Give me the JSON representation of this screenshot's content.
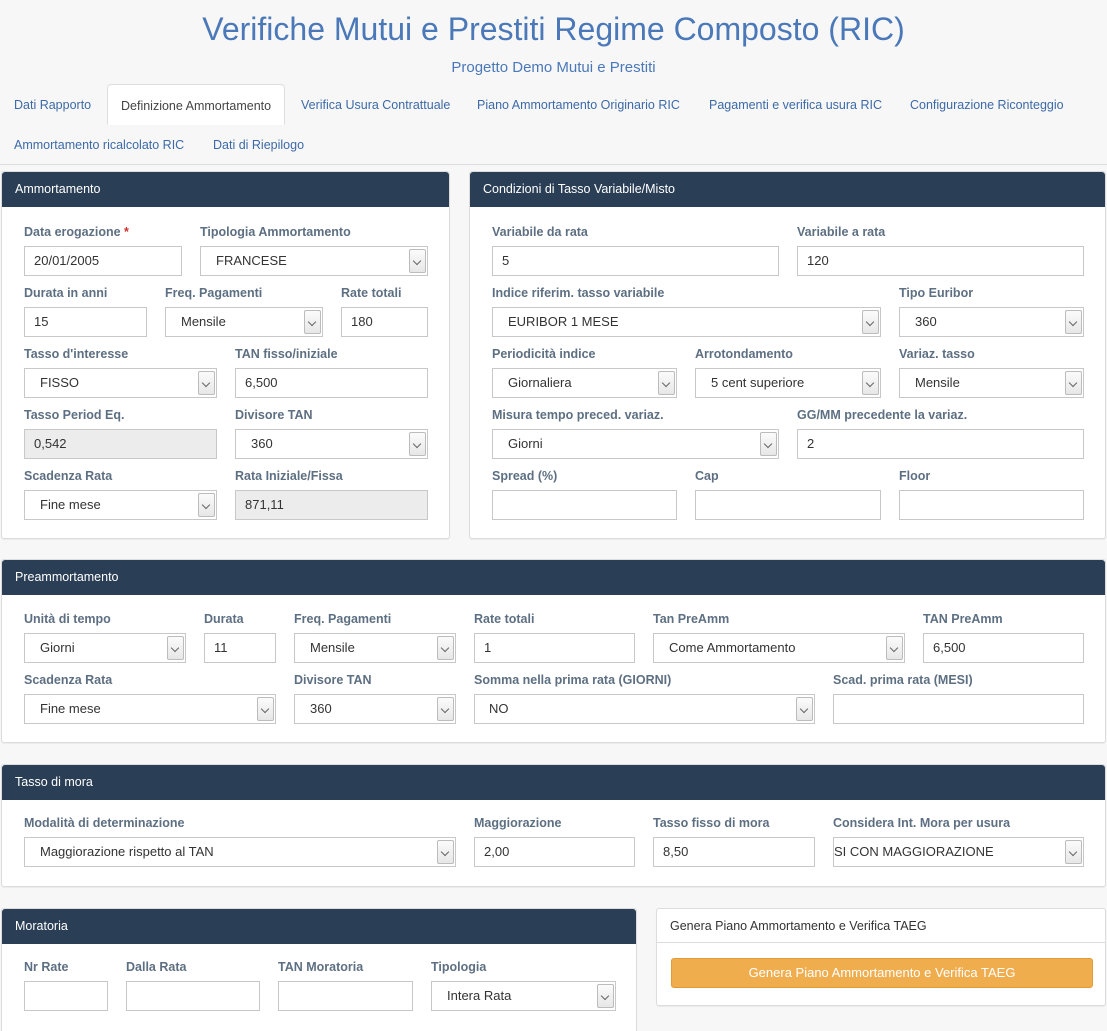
{
  "header": {
    "title": "Verifiche Mutui e Prestiti Regime Composto (RIC)",
    "subtitle": "Progetto Demo Mutui e Prestiti"
  },
  "tabs": [
    {
      "label": "Dati Rapporto"
    },
    {
      "label": "Definizione Ammortamento",
      "active": true
    },
    {
      "label": "Verifica Usura Contrattuale"
    },
    {
      "label": "Piano Ammortamento Originario RIC"
    },
    {
      "label": "Pagamenti e verifica usura RIC"
    },
    {
      "label": "Configurazione Riconteggio"
    },
    {
      "label": "Ammortamento ricalcolato RIC"
    },
    {
      "label": "Dati di Riepilogo"
    }
  ],
  "ammortamento": {
    "heading": "Ammortamento",
    "data_erogazione": {
      "label": "Data erogazione",
      "required_mark": "*",
      "value": "20/01/2005"
    },
    "tipologia": {
      "label": "Tipologia Ammortamento",
      "value": "FRANCESE"
    },
    "durata_anni": {
      "label": "Durata in anni",
      "value": "15"
    },
    "freq_pagamenti": {
      "label": "Freq. Pagamenti",
      "value": "Mensile"
    },
    "rate_totali": {
      "label": "Rate totali",
      "value": "180"
    },
    "tasso_interesse": {
      "label": "Tasso d'interesse",
      "value": "FISSO"
    },
    "tan_fisso": {
      "label": "TAN fisso/iniziale",
      "value": "6,500"
    },
    "tasso_period": {
      "label": "Tasso Period Eq.",
      "value": "0,542"
    },
    "divisore_tan": {
      "label": "Divisore TAN",
      "value": "360"
    },
    "scadenza_rata": {
      "label": "Scadenza Rata",
      "value": "Fine mese"
    },
    "rata_iniziale": {
      "label": "Rata Iniziale/Fissa",
      "value": "871,11"
    }
  },
  "condizioni": {
    "heading": "Condizioni di Tasso Variabile/Misto",
    "variabile_da_rata": {
      "label": "Variabile da rata",
      "value": "5"
    },
    "variabile_a_rata": {
      "label": "Variabile a rata",
      "value": "120"
    },
    "indice_riferim": {
      "label": "Indice riferim. tasso variabile",
      "value": "EURIBOR 1 MESE"
    },
    "tipo_euribor": {
      "label": "Tipo Euribor",
      "value": "360"
    },
    "periodicita": {
      "label": "Periodicità indice",
      "value": "Giornaliera"
    },
    "arrotondamento": {
      "label": "Arrotondamento",
      "value": "5 cent superiore"
    },
    "variaz_tasso": {
      "label": "Variaz. tasso",
      "value": "Mensile"
    },
    "misura_tempo": {
      "label": "Misura tempo preced. variaz.",
      "value": "Giorni"
    },
    "gg_mm": {
      "label": "GG/MM precedente la variaz.",
      "value": "2"
    },
    "spread": {
      "label": "Spread (%)",
      "value": ""
    },
    "cap": {
      "label": "Cap",
      "value": ""
    },
    "floor": {
      "label": "Floor",
      "value": ""
    }
  },
  "preammortamento": {
    "heading": "Preammortamento",
    "unita_tempo": {
      "label": "Unità di tempo",
      "value": "Giorni"
    },
    "durata": {
      "label": "Durata",
      "value": "11"
    },
    "freq_pagamenti": {
      "label": "Freq. Pagamenti",
      "value": "Mensile"
    },
    "rate_totali": {
      "label": "Rate totali",
      "value": "1"
    },
    "tan_preamm_sel": {
      "label": "Tan PreAmm",
      "value": "Come Ammortamento"
    },
    "tan_preamm_val": {
      "label": "TAN PreAmm",
      "value": "6,500"
    },
    "scadenza_rata": {
      "label": "Scadenza Rata",
      "value": "Fine mese"
    },
    "divisore_tan": {
      "label": "Divisore TAN",
      "value": "360"
    },
    "somma_prima_rata": {
      "label": "Somma nella prima rata (GIORNI)",
      "value": "NO"
    },
    "scad_prima_rata": {
      "label": "Scad. prima rata (MESI)",
      "value": ""
    }
  },
  "mora": {
    "heading": "Tasso di mora",
    "modalita": {
      "label": "Modalità di determinazione",
      "value": "Maggiorazione rispetto al TAN"
    },
    "maggiorazione": {
      "label": "Maggiorazione",
      "value": "2,00"
    },
    "tasso_fisso": {
      "label": "Tasso fisso di mora",
      "value": "8,50"
    },
    "considera": {
      "label": "Considera Int. Mora per usura",
      "value": "SI CON MAGGIORAZIONE"
    }
  },
  "moratoria": {
    "heading": "Moratoria",
    "nr_rate": {
      "label": "Nr Rate",
      "value": ""
    },
    "dalla_rata": {
      "label": "Dalla Rata",
      "value": ""
    },
    "tan_moratoria": {
      "label": "TAN Moratoria",
      "value": ""
    },
    "tipologia": {
      "label": "Tipologia",
      "value": "Intera Rata"
    }
  },
  "genera": {
    "heading": "Genera Piano Ammortamento e Verifica TAEG",
    "button_label": "Genera Piano Ammortamento e Verifica TAEG"
  }
}
